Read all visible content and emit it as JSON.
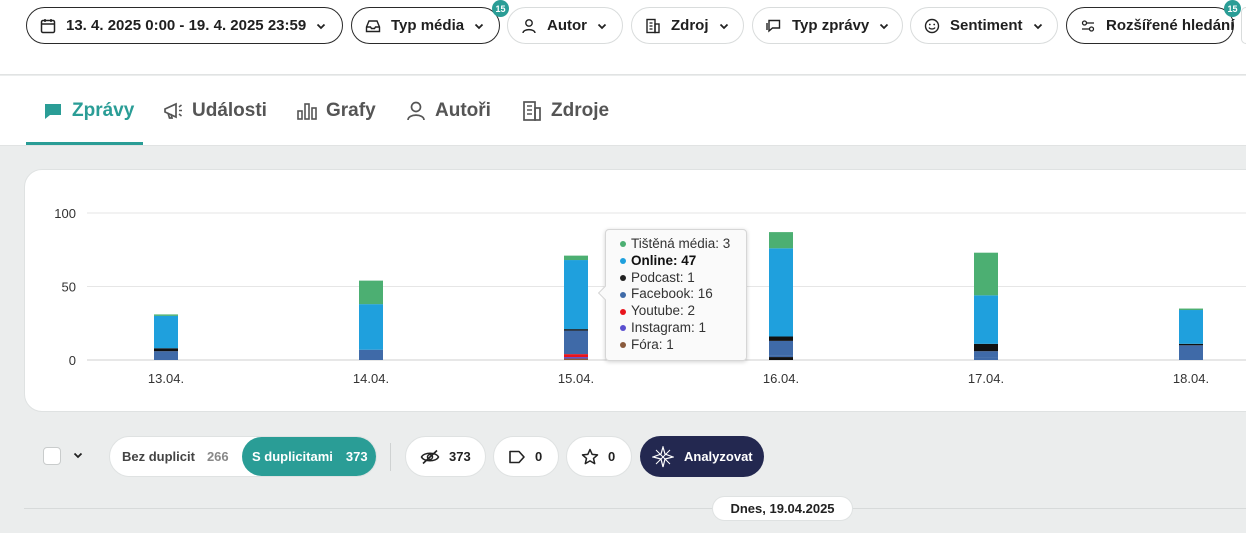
{
  "filters": {
    "date_range": "13. 4. 2025 0:00 - 19. 4. 2025 23:59",
    "media_type": "Typ média",
    "media_type_badge": "15",
    "author": "Autor",
    "source": "Zdroj",
    "message_type": "Typ zprávy",
    "sentiment": "Sentiment",
    "advanced_search": "Rozšířené hledání",
    "advanced_search_badge": "15"
  },
  "tabs": [
    {
      "label": "Zprávy",
      "icon": "chat-bubble-icon",
      "active": true
    },
    {
      "label": "Události",
      "icon": "megaphone-icon",
      "active": false
    },
    {
      "label": "Grafy",
      "icon": "bar-chart-icon",
      "active": false
    },
    {
      "label": "Autoři",
      "icon": "person-icon",
      "active": false
    },
    {
      "label": "Zdroje",
      "icon": "building-icon",
      "active": false
    }
  ],
  "chart_data": {
    "type": "bar",
    "stacked": true,
    "categories": [
      "13.04.",
      "14.04.",
      "15.04.",
      "16.04.",
      "17.04.",
      "18.04."
    ],
    "ylim": [
      0,
      100
    ],
    "yticks": [
      0,
      50,
      100
    ],
    "grid": true,
    "series": [
      {
        "name": "Fóra",
        "color": "#8a5a3c",
        "values": [
          0,
          0,
          1,
          0,
          0,
          0
        ]
      },
      {
        "name": "Instagram",
        "color": "#5a4fcf",
        "values": [
          0,
          0,
          1,
          0,
          0,
          0
        ]
      },
      {
        "name": "Youtube",
        "color": "#e8141c",
        "values": [
          0,
          0,
          2,
          0,
          0,
          0
        ]
      },
      {
        "name": "Facebook",
        "color": "#3f6aa8",
        "values": [
          6,
          7,
          16,
          10,
          4,
          10
        ]
      },
      {
        "name": "Podcast",
        "color": "#111111",
        "values": [
          2,
          0,
          1,
          3,
          5,
          1
        ]
      },
      {
        "name": "Online",
        "color": "#1fa0dd",
        "values": [
          22,
          31,
          47,
          60,
          33,
          23
        ]
      },
      {
        "name": "Tištěná média",
        "color": "#4caf72",
        "values": [
          1,
          16,
          3,
          11,
          29,
          1
        ]
      }
    ],
    "extra_segments": [
      {
        "category": "16.04.",
        "series": "Podcast",
        "value": 2,
        "position": "bottom"
      },
      {
        "category": "16.04.",
        "series": "Facebook",
        "value": 1,
        "position": "bottom"
      },
      {
        "category": "17.04.",
        "series": "Facebook",
        "value": 2,
        "position": "bottom"
      }
    ],
    "tooltip": {
      "category": "15.04.",
      "rows": [
        {
          "label": "Tištěná média: 3",
          "color": "#4caf72",
          "bold": false
        },
        {
          "label": "Online: 47",
          "color": "#1fa0dd",
          "bold": true
        },
        {
          "label": "Podcast: 1",
          "color": "#222222",
          "bold": false
        },
        {
          "label": "Facebook: 16",
          "color": "#3f6aa8",
          "bold": false
        },
        {
          "label": "Youtube: 2",
          "color": "#e8141c",
          "bold": false
        },
        {
          "label": "Instagram: 1",
          "color": "#5a4fcf",
          "bold": false
        },
        {
          "label": "Fóra: 1",
          "color": "#8a5a3c",
          "bold": false
        }
      ]
    }
  },
  "actions": {
    "no_duplicates_label": "Bez duplicit",
    "no_duplicates_count": "266",
    "with_duplicates_label": "S duplicitami",
    "with_duplicates_count": "373",
    "seen_count": "373",
    "tag_count": "0",
    "star_count": "0",
    "analyze_label": "Analyzovat"
  },
  "date_divider": "Dnes, 19.04.2025",
  "colors": {
    "accent": "#2a9d96",
    "analyze_bg": "#232850"
  }
}
